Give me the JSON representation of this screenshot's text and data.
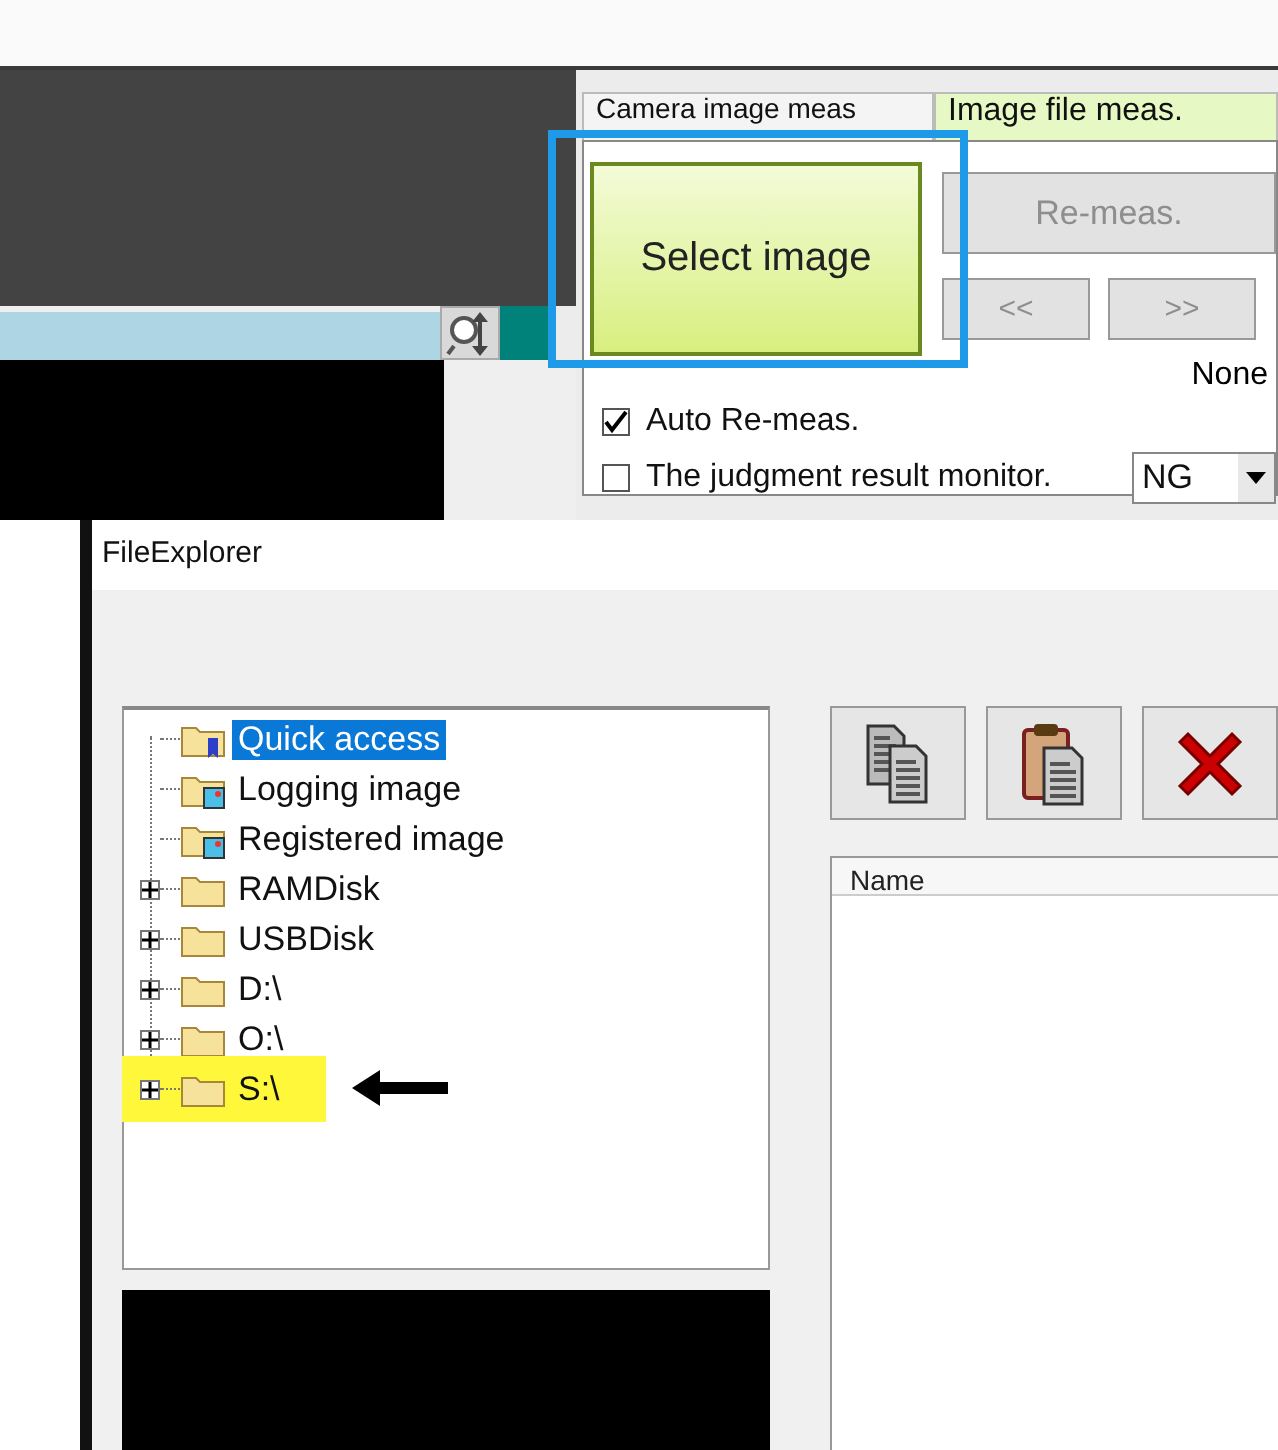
{
  "tabs": [
    {
      "label": "Camera image meas",
      "selected": false
    },
    {
      "label": "Image file meas.",
      "selected": true
    }
  ],
  "select_button": {
    "label": "Select image",
    "highlighted": true
  },
  "buttons": [
    {
      "label": "Re-meas.",
      "disabled": true
    },
    {
      "label": "<<",
      "disabled": true
    },
    {
      "label": ">>",
      "disabled": true
    }
  ],
  "file_status": "None",
  "checkboxes": [
    {
      "label": "Auto Re-meas.",
      "checked": true
    },
    {
      "label": "The judgment result monitor.",
      "checked": false
    }
  ],
  "dropdown": {
    "value": "NG"
  },
  "dialog": {
    "title": "FileExplorer",
    "tree": [
      {
        "label": "Quick access",
        "kind": "quick",
        "selected": true,
        "highlighted": false
      },
      {
        "label": "Logging image",
        "kind": "image",
        "selected": false,
        "highlighted": false
      },
      {
        "label": "Registered image",
        "kind": "image",
        "selected": false,
        "highlighted": false
      },
      {
        "label": "RAMDisk",
        "kind": "folder",
        "selected": false,
        "highlighted": false
      },
      {
        "label": "USBDisk",
        "kind": "folder",
        "selected": false,
        "highlighted": false
      },
      {
        "label": "D:\\",
        "kind": "folder",
        "selected": false,
        "highlighted": false
      },
      {
        "label": "O:\\",
        "kind": "folder",
        "selected": false,
        "highlighted": false
      },
      {
        "label": "S:\\",
        "kind": "folder",
        "selected": false,
        "highlighted": true
      }
    ],
    "toolbar": [
      {
        "kind": "copy"
      },
      {
        "kind": "paste"
      },
      {
        "kind": "delete"
      }
    ],
    "columns": [
      "Name"
    ]
  }
}
